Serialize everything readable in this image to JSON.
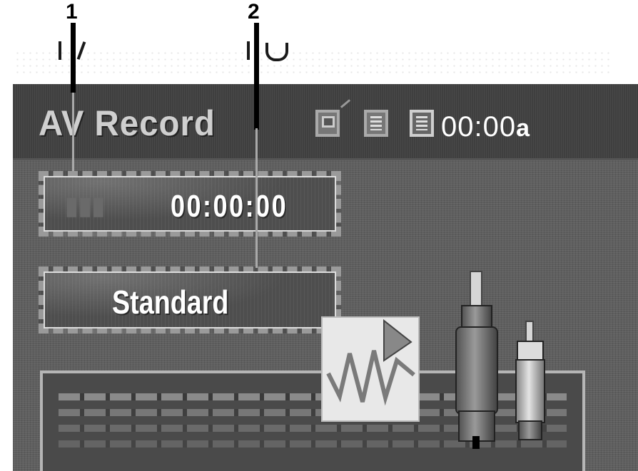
{
  "callouts": {
    "one": "1",
    "two": "2"
  },
  "osd": {
    "title": "AV Record",
    "clock": "00:00",
    "clock_suffix": "a",
    "status_icons": [
      "tv-antenna-icon",
      "disc-icon",
      "disc-active-icon"
    ]
  },
  "panels": {
    "recording_time": "00:00:00",
    "record_mode": "Standard"
  },
  "colors": {
    "screen_bg": "#5f5f5f",
    "title_bar": "#3f3f3f",
    "text": "#ffffff",
    "callout_line": "#000000"
  }
}
